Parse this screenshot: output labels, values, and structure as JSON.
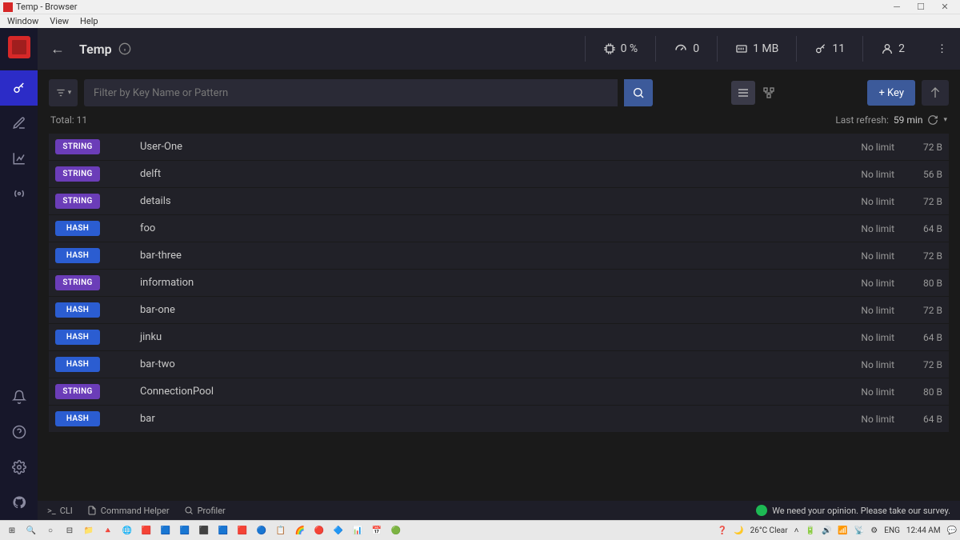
{
  "window": {
    "title": "Temp - Browser"
  },
  "menubar": [
    "Window",
    "View",
    "Help"
  ],
  "header": {
    "db_name": "Temp",
    "stats": {
      "cpu": "0 %",
      "commands": "0",
      "memory": "1 MB",
      "keys": "11",
      "clients": "2"
    }
  },
  "toolbar": {
    "search_placeholder": "Filter by Key Name or Pattern",
    "add_key_label": "+ Key"
  },
  "totals": {
    "total_label": "Total: 11",
    "last_refresh_label": "Last refresh:",
    "last_refresh_value": "59 min"
  },
  "keys": [
    {
      "type": "STRING",
      "name": "User-One",
      "ttl": "No limit",
      "size": "72 B"
    },
    {
      "type": "STRING",
      "name": "delft",
      "ttl": "No limit",
      "size": "56 B"
    },
    {
      "type": "STRING",
      "name": "details",
      "ttl": "No limit",
      "size": "72 B"
    },
    {
      "type": "HASH",
      "name": "foo",
      "ttl": "No limit",
      "size": "64 B"
    },
    {
      "type": "HASH",
      "name": "bar-three",
      "ttl": "No limit",
      "size": "72 B"
    },
    {
      "type": "STRING",
      "name": "information",
      "ttl": "No limit",
      "size": "80 B"
    },
    {
      "type": "HASH",
      "name": "bar-one",
      "ttl": "No limit",
      "size": "72 B"
    },
    {
      "type": "HASH",
      "name": "jinku",
      "ttl": "No limit",
      "size": "64 B"
    },
    {
      "type": "HASH",
      "name": "bar-two",
      "ttl": "No limit",
      "size": "72 B"
    },
    {
      "type": "STRING",
      "name": "ConnectionPool",
      "ttl": "No limit",
      "size": "80 B"
    },
    {
      "type": "HASH",
      "name": "bar",
      "ttl": "No limit",
      "size": "64 B"
    }
  ],
  "bottombar": {
    "cli": "CLI",
    "command_helper": "Command Helper",
    "profiler": "Profiler",
    "survey": "We need your opinion. Please take our survey."
  },
  "taskbar": {
    "weather": "26°C  Clear",
    "lang": "ENG",
    "time": "12:44 AM"
  }
}
